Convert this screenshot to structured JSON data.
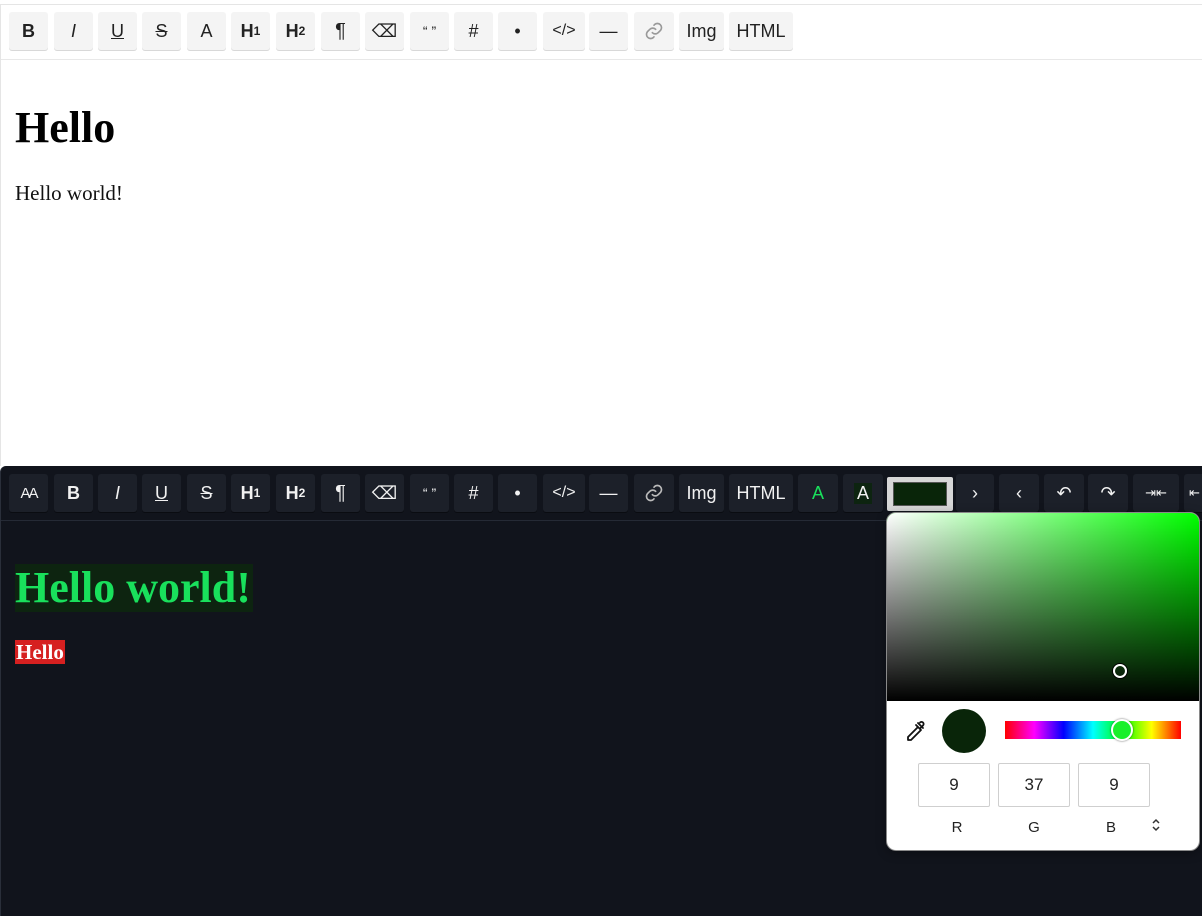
{
  "light_editor": {
    "toolbar": [
      "B",
      "I",
      "U",
      "S",
      "A",
      "H",
      "H",
      "¶",
      "⌫",
      "“ ”",
      "#",
      "•",
      "</>",
      "—",
      "link",
      "Img",
      "HTML"
    ],
    "heading": "Hello",
    "paragraph": "Hello world!"
  },
  "dark_editor": {
    "toolbar_left": [
      "AA",
      "B",
      "I",
      "U",
      "S",
      "H",
      "H",
      "¶",
      "⌫",
      "“ ”",
      "#",
      "•",
      "</>",
      "—",
      "link",
      "Img",
      "HTML",
      "A",
      "A"
    ],
    "toolbar_right": [
      "›",
      "‹",
      "↶",
      "↷",
      "⇥⇤",
      "⇤"
    ],
    "heading": "Hello world!",
    "paragraph": "Hello",
    "heading_color": "#19e05c",
    "heading_background": "#0d2410",
    "paragraph_background": "#d62020"
  },
  "color_picker": {
    "hue_color": "#00ff00",
    "selected_color": "#092509",
    "r": "9",
    "g": "37",
    "b": "9",
    "label_r": "R",
    "label_g": "G",
    "label_b": "B",
    "mode_toggle": "⌃⌄"
  },
  "icons": {
    "link": "link-icon",
    "eyedropper": "eyedropper-icon",
    "clear_format": "eraser-icon"
  }
}
